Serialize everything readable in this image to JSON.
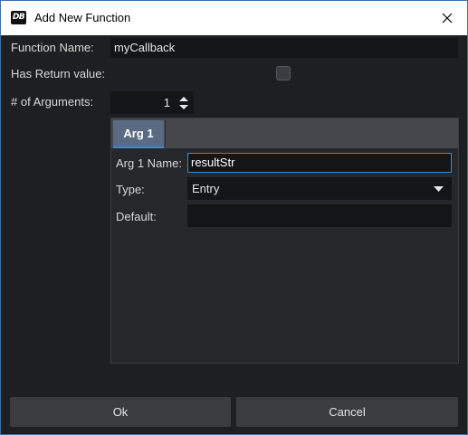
{
  "window": {
    "title": "Add New Function",
    "app_icon_text": "DB",
    "close_icon": "close-icon"
  },
  "form": {
    "function_name_label": "Function Name:",
    "function_name_value": "myCallback",
    "has_return_label": "Has Return value:",
    "has_return_checked": false,
    "num_args_label": "# of Arguments:",
    "num_args_value": "1"
  },
  "tabs": [
    {
      "label": "Arg 1",
      "active": true,
      "fields": {
        "name_label": "Arg 1 Name:",
        "name_value": "resultStr",
        "type_label": "Type:",
        "type_value": "Entry",
        "default_label": "Default:",
        "default_value": ""
      }
    }
  ],
  "buttons": {
    "ok_label": "Ok",
    "cancel_label": "Cancel"
  },
  "colors": {
    "accent": "#3c89c9",
    "background": "#1e1f22",
    "field_background": "#141517",
    "button_background": "#3b3c40"
  }
}
